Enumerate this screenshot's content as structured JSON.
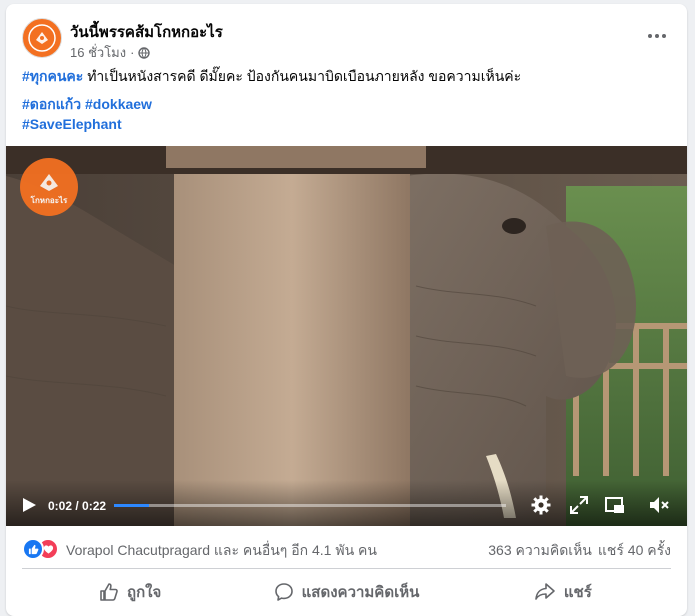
{
  "post": {
    "page_name": "วันนี้พรรคส้มโกหกอะไร",
    "timestamp": "16 ชั่วโมง",
    "audience_icon": "globe-icon",
    "more_icon": "more-icon",
    "text_line1_tag": "#ทุกคนคะ",
    "text_line1_body": " ทำเป็นหนังสารคดี ดีมั๊ยคะ ป้องกันคนมาบิดเบือนภายหลัง ขอความเห็นค่ะ",
    "hashtag1": "#ดอกแก้ว",
    "hashtag2": "#dokkaew",
    "hashtag3": "#SaveElephant",
    "watermark_text": "โกหกอะไร"
  },
  "video": {
    "time": "0:02 / 0:22",
    "progress": 0.09,
    "icons": [
      "play-icon",
      "settings-icon",
      "fullscreen-icon",
      "pip-icon",
      "mute-icon"
    ]
  },
  "reactions": {
    "icons": [
      "like-reaction-icon",
      "love-reaction-icon"
    ],
    "names": "Vorapol Chacutpragard และ คนอื่นๆ อีก 4.1 พัน คน",
    "comments": "363 ความคิดเห็น",
    "shares": "แชร์ 40 ครั้ง"
  },
  "actions": {
    "like": "ถูกใจ",
    "comment": "แสดงความคิดเห็น",
    "share": "แชร์"
  },
  "colors": {
    "brand_orange": "#f37021",
    "hashtag_blue": "#216fdb",
    "progress_blue": "#2d88ff",
    "like_blue": "#1877f2",
    "love_red": "#f33e58"
  }
}
